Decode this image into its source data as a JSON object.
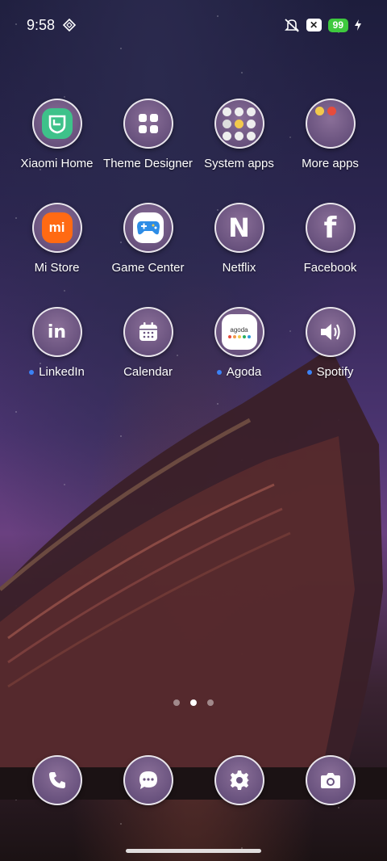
{
  "status": {
    "time": "9:58",
    "battery": "99",
    "x_badge": "✕"
  },
  "apps": [
    {
      "label": "Xiaomi Home",
      "icon": "xiaomi-home-icon",
      "dot": false
    },
    {
      "label": "Theme Designer",
      "icon": "theme-designer-icon",
      "dot": false
    },
    {
      "label": "System apps",
      "icon": "folder-icon",
      "dot": false
    },
    {
      "label": "More apps",
      "icon": "folder-icon",
      "dot": false
    },
    {
      "label": "Mi Store",
      "icon": "mi-store-icon",
      "dot": false
    },
    {
      "label": "Game Center",
      "icon": "game-controller-icon",
      "dot": false
    },
    {
      "label": "Netflix",
      "icon": "netflix-icon",
      "dot": false
    },
    {
      "label": "Facebook",
      "icon": "facebook-icon",
      "dot": false
    },
    {
      "label": "LinkedIn",
      "icon": "linkedin-icon",
      "dot": true
    },
    {
      "label": "Calendar",
      "icon": "calendar-icon",
      "dot": false
    },
    {
      "label": "Agoda",
      "icon": "agoda-icon",
      "dot": true
    },
    {
      "label": "Spotify",
      "icon": "speaker-icon",
      "dot": true
    }
  ],
  "icon_text": {
    "mi": "mi",
    "netflix": "N",
    "facebook": "f",
    "linkedin": "in",
    "agoda": "agoda"
  },
  "dock": [
    {
      "icon": "phone-icon"
    },
    {
      "icon": "messages-icon"
    },
    {
      "icon": "settings-icon"
    },
    {
      "icon": "camera-icon"
    }
  ],
  "colors": {
    "battery": "#3ec93e",
    "notification_dot": "#3b82f6"
  }
}
